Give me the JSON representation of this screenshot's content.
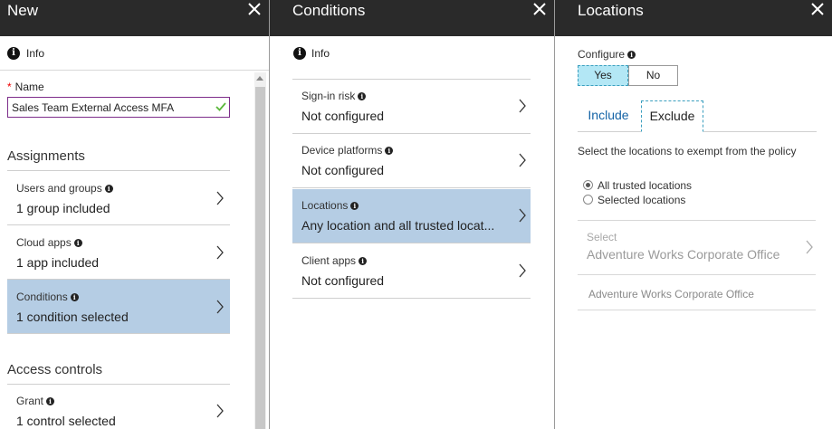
{
  "blades": {
    "new": {
      "title": "New",
      "info": "Info",
      "name_label": "Name",
      "name_value": "Sales Team External Access MFA",
      "assignments_heading": "Assignments",
      "assignments": [
        {
          "label": "Users and groups",
          "value": "1 group included"
        },
        {
          "label": "Cloud apps",
          "value": "1 app included"
        },
        {
          "label": "Conditions",
          "value": "1 condition selected"
        }
      ],
      "access_heading": "Access controls",
      "access": [
        {
          "label": "Grant",
          "value": "1 control selected"
        }
      ]
    },
    "conditions": {
      "title": "Conditions",
      "info": "Info",
      "items": [
        {
          "label": "Sign-in risk",
          "value": "Not configured"
        },
        {
          "label": "Device platforms",
          "value": "Not configured"
        },
        {
          "label": "Locations",
          "value": "Any location and all trusted locat..."
        },
        {
          "label": "Client apps",
          "value": "Not configured"
        }
      ]
    },
    "locations": {
      "title": "Locations",
      "configure_label": "Configure",
      "yes": "Yes",
      "no": "No",
      "tabs": {
        "include": "Include",
        "exclude": "Exclude"
      },
      "description": "Select the locations to exempt from the policy",
      "options": [
        "All trusted locations",
        "Selected locations"
      ],
      "select_label": "Select",
      "select_value": "Adventure Works Corporate Office",
      "entry": "Adventure Works Corporate Office"
    }
  },
  "icons": {
    "close": "close-icon",
    "info": "info-icon",
    "chevron": "chevron-right-icon",
    "check": "checkmark-icon"
  },
  "colors": {
    "header_bg": "#2a2a2a",
    "selected_row": "#b5cde4",
    "toggle_active": "#b3e7f5",
    "input_border": "#7d2d8a",
    "tab_link": "#1463a6",
    "check": "#5bb73b"
  }
}
